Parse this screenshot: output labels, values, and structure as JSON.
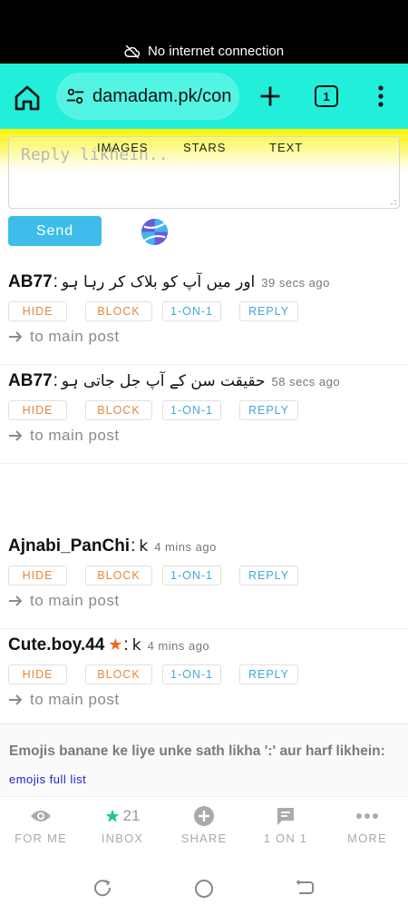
{
  "status_bar": {
    "network_message": "No internet connection"
  },
  "browser": {
    "url": "damadam.pk/con",
    "tab_count": "1"
  },
  "reply": {
    "placeholder": "Reply likhein..",
    "tabs": [
      "IMAGES",
      "STARS",
      "TEXT"
    ],
    "send_label": "Send"
  },
  "action_labels": {
    "hide": "HIDE",
    "block": "BLOCK",
    "one_on_one": "1-ON-1",
    "reply": "REPLY"
  },
  "to_main_post": "to main post",
  "comments": [
    {
      "user": "AB77",
      "message": "اور میں آپ کو بلاک کر رہا ہو",
      "time": "39 secs ago"
    },
    {
      "user": "AB77",
      "message": "حقیقت سن کے آپ جل جاتی ہو",
      "time": "58 secs ago"
    },
    {
      "user": "Ajnabi_PanChi",
      "message": "k",
      "time": "4 mins ago"
    },
    {
      "user": "Cute.boy.44",
      "message": "k",
      "time": "4 mins ago",
      "starred": true
    }
  ],
  "emoji_panel": {
    "hint": "Emojis banane ke liye unke sath likha ':' aur harf likhein:",
    "link": "emojis full list"
  },
  "bottom_nav": [
    {
      "label": "FOR ME",
      "icon": "eye-icon"
    },
    {
      "label": "INBOX",
      "icon": "star-icon",
      "count": "21"
    },
    {
      "label": "SHARE",
      "icon": "plus-circle-icon"
    },
    {
      "label": "1 ON 1",
      "icon": "chat-bubble-icon"
    },
    {
      "label": "MORE",
      "icon": "more-dots-icon"
    }
  ],
  "colors": {
    "browser_bar": "#22efd9",
    "send_button": "#3fbdea",
    "hide_block_text": "#e2893f",
    "one_reply_text": "#40a9d6",
    "inbox_star": "#1fc4a0"
  }
}
